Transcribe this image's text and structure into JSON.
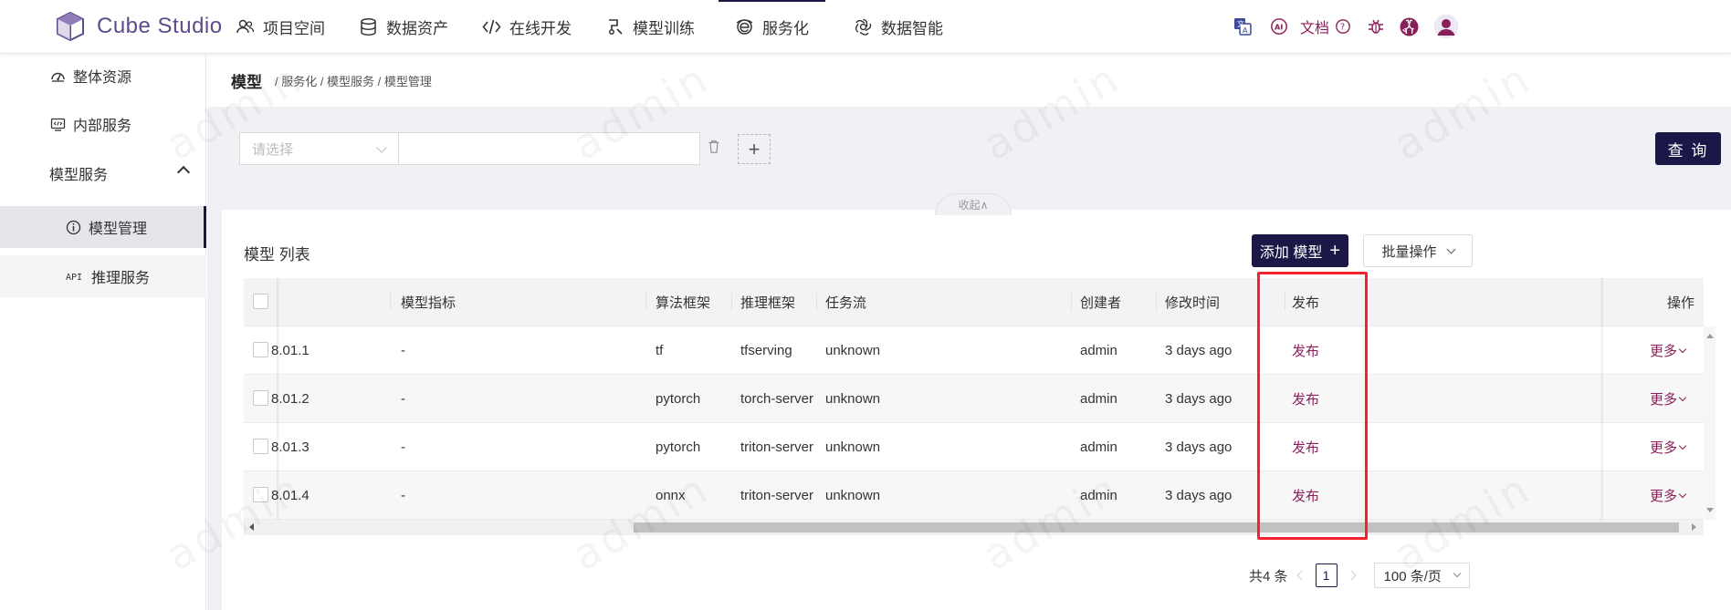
{
  "app": {
    "name": "Cube Studio"
  },
  "nav": [
    {
      "label": "项目空间",
      "icon": "users-icon"
    },
    {
      "label": "数据资产",
      "icon": "database-icon"
    },
    {
      "label": "在线开发",
      "icon": "code-icon"
    },
    {
      "label": "模型训练",
      "icon": "training-icon"
    },
    {
      "label": "服务化",
      "icon": "service-icon",
      "active": true
    },
    {
      "label": "数据智能",
      "icon": "openai-icon"
    }
  ],
  "header_right": {
    "docs_label": "文档"
  },
  "sidebar": {
    "items": [
      {
        "label": "整体资源",
        "icon": "dashboard-icon"
      },
      {
        "label": "内部服务",
        "icon": "monitor-icon"
      },
      {
        "label": "模型服务",
        "expanded": true
      },
      {
        "label": "模型管理",
        "icon": "info-icon",
        "active": true
      },
      {
        "label": "推理服务",
        "icon": "api-icon"
      }
    ]
  },
  "breadcrumb": {
    "title": "模型",
    "path": "/ 服务化 / 模型服务 / 模型管理"
  },
  "filter": {
    "select_placeholder": "请选择",
    "query_label": "查 询",
    "collapse_label": "收起∧"
  },
  "list": {
    "title": "模型 列表",
    "add_label": "添加 模型",
    "batch_label": "批量操作",
    "columns": {
      "metric": "模型指标",
      "algo": "算法框架",
      "infer": "推理框架",
      "pipeline": "任务流",
      "creator": "创建者",
      "modified": "修改时间",
      "publish": "发布",
      "ops": "操作"
    },
    "rows": [
      {
        "version": "8.01.1",
        "metric": "-",
        "algo": "tf",
        "infer": "tfserving",
        "pipeline": "unknown",
        "creator": "admin",
        "modified": "3 days ago",
        "publish": "发布",
        "more": "更多"
      },
      {
        "version": "8.01.2",
        "metric": "-",
        "algo": "pytorch",
        "infer": "torch-server",
        "pipeline": "unknown",
        "creator": "admin",
        "modified": "3 days ago",
        "publish": "发布",
        "more": "更多"
      },
      {
        "version": "8.01.3",
        "metric": "-",
        "algo": "pytorch",
        "infer": "triton-server",
        "pipeline": "unknown",
        "creator": "admin",
        "modified": "3 days ago",
        "publish": "发布",
        "more": "更多"
      },
      {
        "version": "8.01.4",
        "metric": "-",
        "algo": "onnx",
        "infer": "triton-server",
        "pipeline": "unknown",
        "creator": "admin",
        "modified": "3 days ago",
        "publish": "发布",
        "more": "更多"
      }
    ]
  },
  "pagination": {
    "total": "共4 条",
    "current": "1",
    "page_size": "100 条/页"
  },
  "watermark": "admin",
  "colors": {
    "primary": "#1b1848",
    "link": "#8b1f5a",
    "highlight": "#f5222d",
    "logo": "#5f4a8b"
  }
}
